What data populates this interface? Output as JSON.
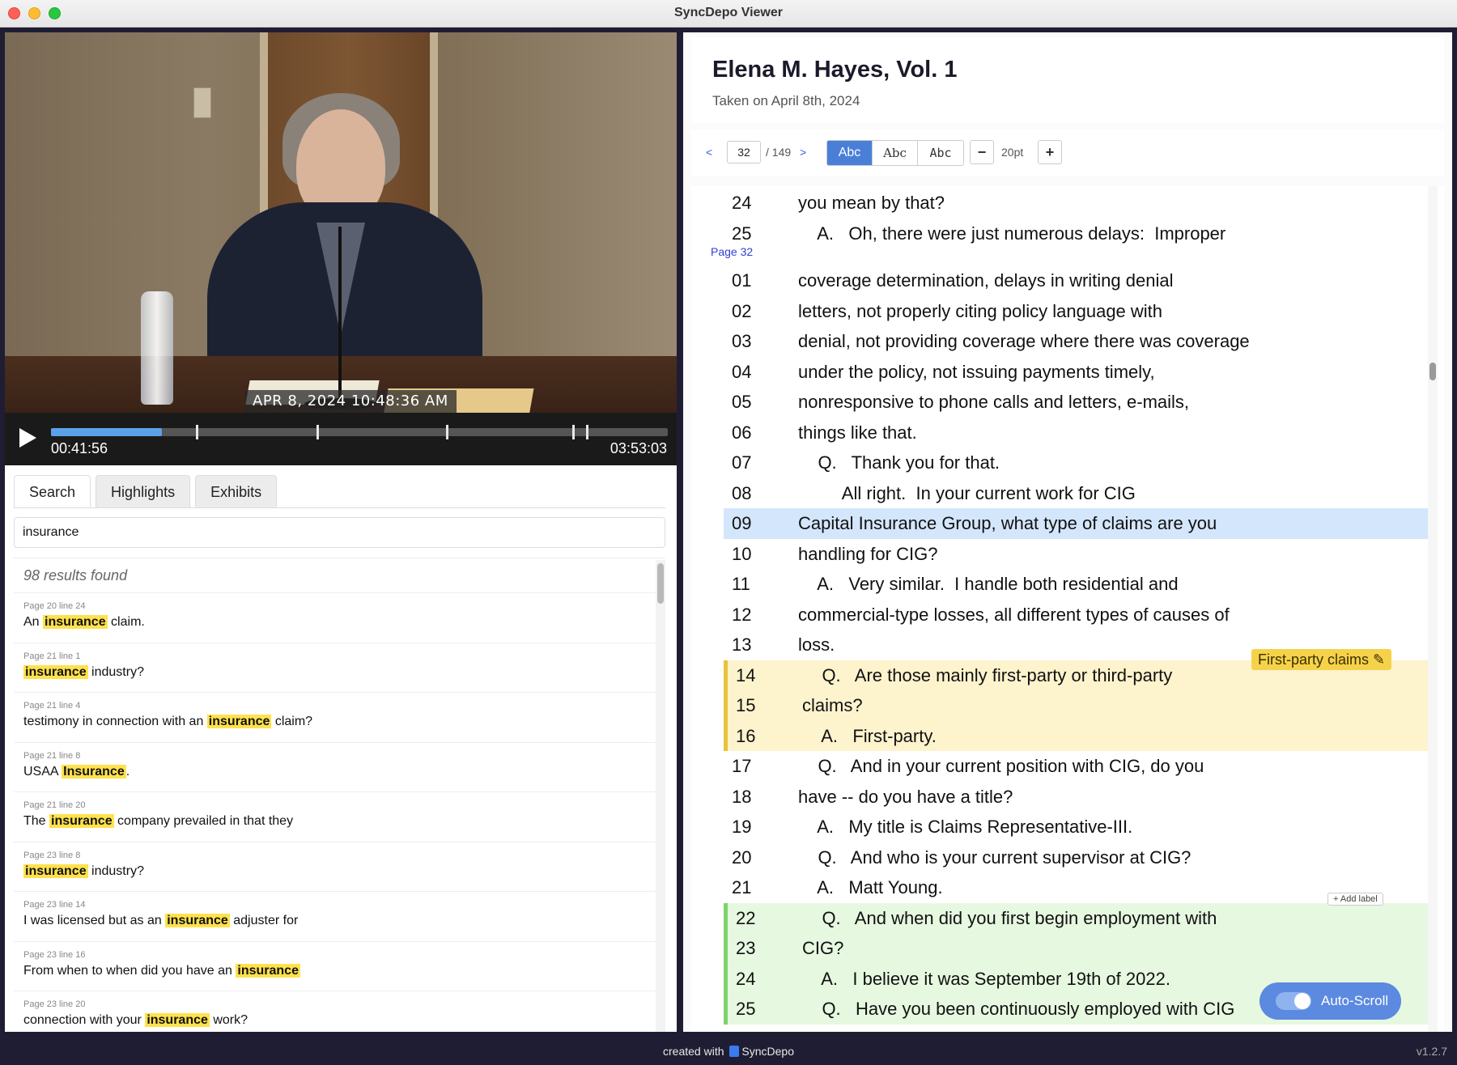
{
  "window": {
    "title": "SyncDepo Viewer"
  },
  "video": {
    "timestamp": "APR 8, 2024 10:48:36 AM",
    "current_time": "00:41:56",
    "total_time": "03:53:03",
    "progress": 0.18,
    "markers": [
      0.235,
      0.43,
      0.64,
      0.845,
      0.868
    ]
  },
  "tabs": [
    "Search",
    "Highlights",
    "Exhibits"
  ],
  "search": {
    "query": "insurance",
    "results_count": "98 results found",
    "results": [
      {
        "loc": "Page 20 line 24",
        "before": "An ",
        "hit": "insurance",
        "after": " claim."
      },
      {
        "loc": "Page 21 line 1",
        "before": "",
        "hit": "insurance",
        "after": " industry?"
      },
      {
        "loc": "Page 21 line 4",
        "before": "testimony in connection with an ",
        "hit": "insurance",
        "after": " claim?"
      },
      {
        "loc": "Page 21 line 8",
        "before": "USAA ",
        "hit": "Insurance",
        "after": "."
      },
      {
        "loc": "Page 21 line 20",
        "before": "The ",
        "hit": "insurance",
        "after": " company prevailed in that they"
      },
      {
        "loc": "Page 23 line 8",
        "before": "",
        "hit": "insurance",
        "after": " industry?"
      },
      {
        "loc": "Page 23 line 14",
        "before": "I was licensed but as an ",
        "hit": "insurance",
        "after": " adjuster for"
      },
      {
        "loc": "Page 23 line 16",
        "before": "From when to when did you have an ",
        "hit": "insurance",
        "after": ""
      },
      {
        "loc": "Page 23 line 20",
        "before": "connection with your ",
        "hit": "insurance",
        "after": " work?"
      }
    ]
  },
  "doc": {
    "title": "Elena M. Hayes, Vol. 1",
    "subtitle": "Taken on April 8th, 2024"
  },
  "toolbar": {
    "prev": "<",
    "next": ">",
    "page": "32",
    "page_total": "/ 149",
    "font_options": [
      "Abc",
      "Abc",
      "Abc"
    ],
    "zoom_minus": "−",
    "zoom_value": "20pt",
    "zoom_plus": "+"
  },
  "transcript": {
    "page_label": "Page 32",
    "prev_lines": [
      {
        "num": "24",
        "text": "you mean by that?"
      },
      {
        "num": "25",
        "text": "    A.   Oh, there were just numerous delays:  Improper"
      }
    ],
    "lines": [
      {
        "num": "01",
        "text": "coverage determination, delays in writing denial",
        "hl": ""
      },
      {
        "num": "02",
        "text": "letters, not properly citing policy language with",
        "hl": ""
      },
      {
        "num": "03",
        "text": "denial, not providing coverage where there was coverage",
        "hl": ""
      },
      {
        "num": "04",
        "text": "under the policy, not issuing payments timely,",
        "hl": ""
      },
      {
        "num": "05",
        "text": "nonresponsive to phone calls and letters, e-mails,",
        "hl": ""
      },
      {
        "num": "06",
        "text": "things like that.",
        "hl": ""
      },
      {
        "num": "07",
        "text": "    Q.   Thank you for that.",
        "hl": ""
      },
      {
        "num": "08",
        "text": "         All right.  In your current work for CIG",
        "hl": ""
      },
      {
        "num": "09",
        "text": "Capital Insurance Group, what type of claims are you",
        "hl": "blue"
      },
      {
        "num": "10",
        "text": "handling for CIG?",
        "hl": ""
      },
      {
        "num": "11",
        "text": "    A.   Very similar.  I handle both residential and",
        "hl": ""
      },
      {
        "num": "12",
        "text": "commercial-type losses, all different types of causes of",
        "hl": ""
      },
      {
        "num": "13",
        "text": "loss.",
        "hl": ""
      },
      {
        "num": "14",
        "text": "    Q.   Are those mainly first-party or third-party",
        "hl": "yellow"
      },
      {
        "num": "15",
        "text": "claims?",
        "hl": "yellow"
      },
      {
        "num": "16",
        "text": "    A.   First-party.",
        "hl": "yellow"
      },
      {
        "num": "17",
        "text": "    Q.   And in your current position with CIG, do you",
        "hl": ""
      },
      {
        "num": "18",
        "text": "have -- do you have a title?",
        "hl": ""
      },
      {
        "num": "19",
        "text": "    A.   My title is Claims Representative-III.",
        "hl": ""
      },
      {
        "num": "20",
        "text": "    Q.   And who is your current supervisor at CIG?",
        "hl": ""
      },
      {
        "num": "21",
        "text": "    A.   Matt Young.",
        "hl": ""
      },
      {
        "num": "22",
        "text": "    Q.   And when did you first begin employment with",
        "hl": "green"
      },
      {
        "num": "23",
        "text": "CIG?",
        "hl": "green"
      },
      {
        "num": "24",
        "text": "    A.   I believe it was September 19th of 2022.",
        "hl": "green"
      },
      {
        "num": "25",
        "text": "    Q.   Have you been continuously employed with CIG",
        "hl": "green"
      }
    ],
    "label_chip": "First-party claims ✎",
    "add_label": "+ Add label"
  },
  "autoscroll": {
    "label": "Auto-Scroll",
    "on": true
  },
  "footer": {
    "made_with": "created with",
    "brand": "SyncDepo",
    "version": "v1.2.7"
  },
  "colors": {
    "accent": "#4a7fd8",
    "highlight": "#ffe14d",
    "blue_line": "#d4e6fb",
    "yellow_line": "#fdf3cd",
    "green_line": "#e6f8e0"
  }
}
